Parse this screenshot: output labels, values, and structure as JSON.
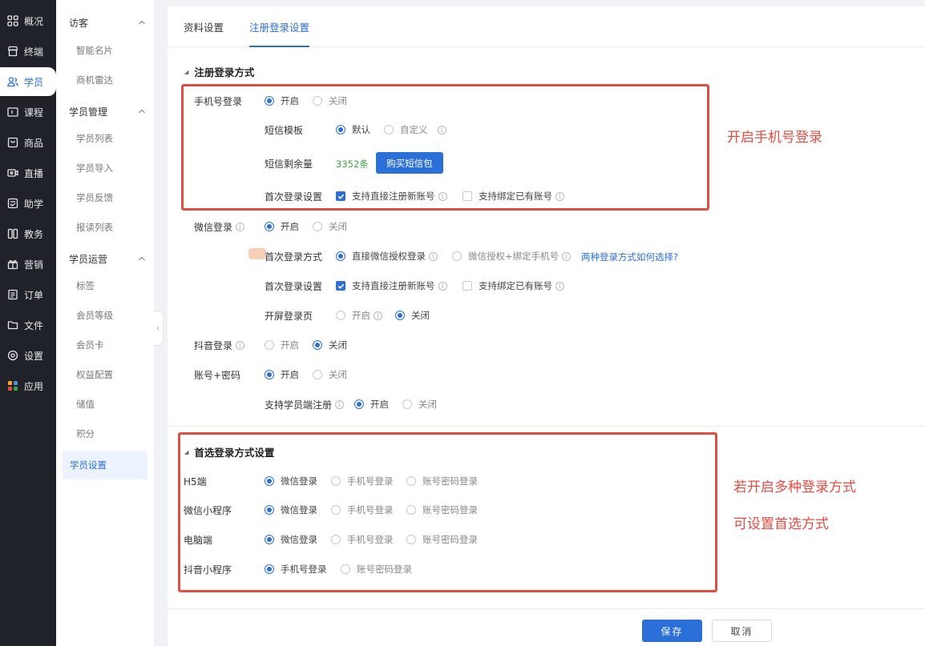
{
  "nav1": [
    {
      "label": "概况",
      "icon": "grid-icon"
    },
    {
      "label": "终端",
      "icon": "store-icon"
    },
    {
      "label": "学员",
      "icon": "users-icon",
      "active": true
    },
    {
      "label": "课程",
      "icon": "course-icon"
    },
    {
      "label": "商品",
      "icon": "bag-icon"
    },
    {
      "label": "直播",
      "icon": "live-icon"
    },
    {
      "label": "助学",
      "icon": "assist-icon"
    },
    {
      "label": "教务",
      "icon": "book-icon"
    },
    {
      "label": "营销",
      "icon": "gift-icon"
    },
    {
      "label": "订单",
      "icon": "order-icon"
    },
    {
      "label": "文件",
      "icon": "folder-icon"
    },
    {
      "label": "设置",
      "icon": "gear-icon"
    },
    {
      "label": "应用",
      "icon": "apps-icon"
    }
  ],
  "nav2": {
    "group_visitor": "访客",
    "visitor_items": [
      "智能名片",
      "商机雷达"
    ],
    "group_manage": "学员管理",
    "manage_items": [
      "学员列表",
      "学员导入",
      "学员反馈",
      "报读列表"
    ],
    "group_ops": "学员运营",
    "ops_items": [
      "标签",
      "会员等级",
      "会员卡",
      "权益配置",
      "储值",
      "积分"
    ],
    "settings_item": "学员设置"
  },
  "tabs": {
    "profile": "资料设置",
    "register": "注册登录设置"
  },
  "section1": {
    "title": "注册登录方式",
    "phone": {
      "label": "手机号登录",
      "on": "开启",
      "off": "关闭",
      "sms_template_label": "短信模板",
      "sms_default": "默认",
      "sms_custom": "自定义",
      "sms_remaining_label": "短信剩余量",
      "sms_remaining_value": "3352条",
      "buy_sms": "购买短信包",
      "first_login_label": "首次登录设置",
      "register_new": "支持直接注册新账号",
      "bind_existing": "支持绑定已有账号"
    },
    "wechat": {
      "label": "微信登录",
      "on": "开启",
      "off": "关闭",
      "first_method_label": "首次登录方式",
      "direct_auth": "直接微信授权登录",
      "auth_bind_phone": "微信授权+绑定手机号",
      "how_choose": "两种登录方式如何选择?",
      "first_login_label": "首次登录设置",
      "register_new": "支持直接注册新账号",
      "bind_existing": "支持绑定已有账号",
      "splash_label": "开屏登录页",
      "splash_on": "开启",
      "splash_off": "关闭"
    },
    "douyin": {
      "label": "抖音登录",
      "on": "开启",
      "off": "关闭"
    },
    "account": {
      "label": "账号+密码",
      "on": "开启",
      "off": "关闭",
      "student_register_label": "支持学员端注册",
      "reg_on": "开启",
      "reg_off": "关闭"
    }
  },
  "section2": {
    "title": "首选登录方式设置",
    "rows": [
      {
        "label": "H5端",
        "opt1": "微信登录",
        "opt2": "手机号登录",
        "opt3": "账号密码登录"
      },
      {
        "label": "微信小程序",
        "opt1": "微信登录",
        "opt2": "手机号登录",
        "opt3": "账号密码登录"
      },
      {
        "label": "电脑端",
        "opt1": "微信登录",
        "opt2": "手机号登录",
        "opt3": "账号密码登录"
      },
      {
        "label": "抖音小程序",
        "opt1": "手机号登录",
        "opt2": "账号密码登录"
      }
    ]
  },
  "annotations": {
    "phone_note": "开启手机号登录",
    "multi_note_1": "若开启多种登录方式",
    "multi_note_2": "可设置首选方式"
  },
  "footer": {
    "save": "保存",
    "cancel": "取消"
  },
  "colors": {
    "primary": "#2b6fd8",
    "annotation_red": "#e24d42",
    "count_green": "#3da83d",
    "sidebar_dark": "#1f2229"
  }
}
